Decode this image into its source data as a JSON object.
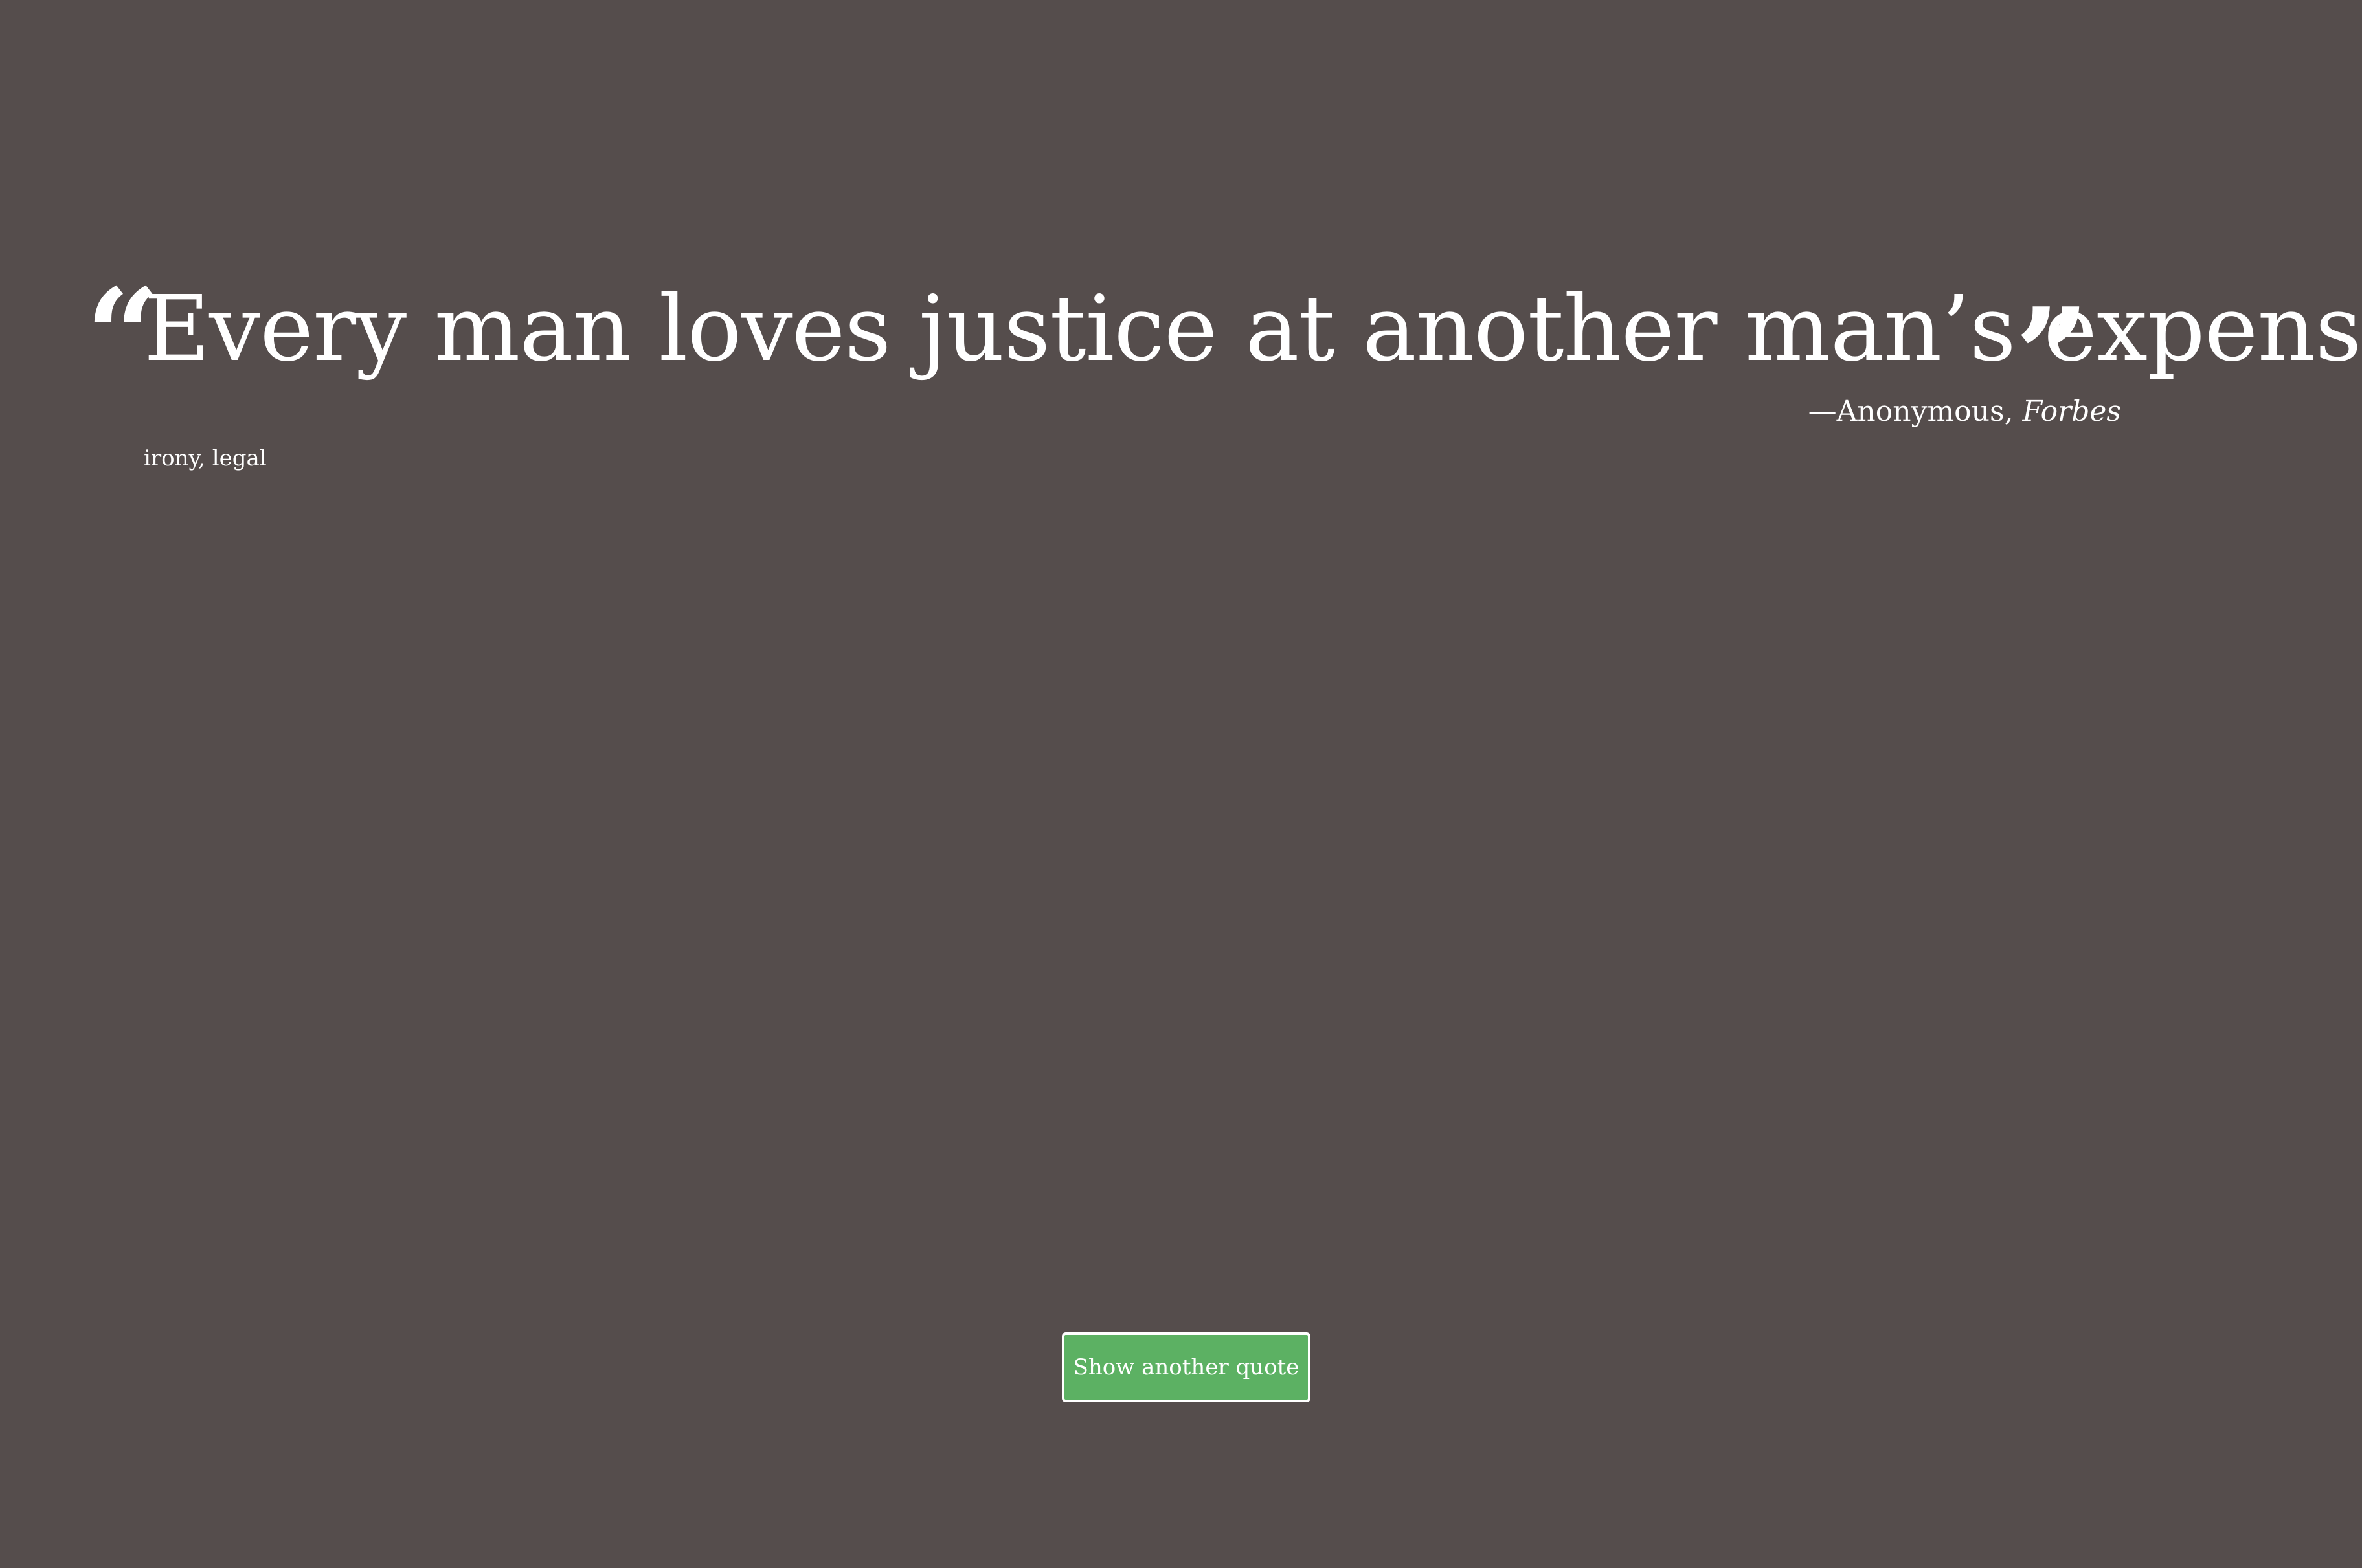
{
  "quote": {
    "open_mark": "“",
    "text": "Every man loves justice at another man’s expense.",
    "close_mark": "”",
    "attribution_prefix": "—Anonymous, ",
    "attribution_source": "Forbes",
    "tags": "irony, legal"
  },
  "controls": {
    "next_label": "Show another quote"
  },
  "colors": {
    "background": "#554d4c",
    "text": "#ffffff",
    "button": "#5cb163"
  }
}
